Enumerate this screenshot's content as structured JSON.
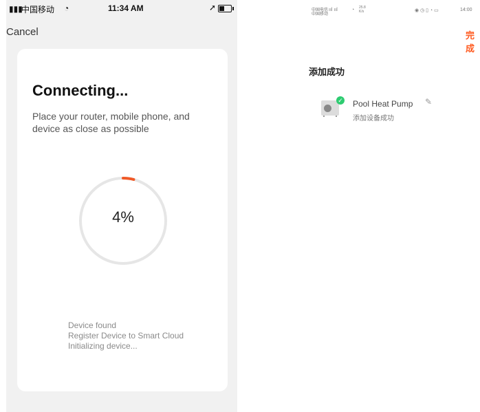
{
  "left_screen": {
    "status_bar": {
      "carrier": "中国移动",
      "time": "11:34 AM",
      "icons": [
        "signal-icon",
        "wifi-icon",
        "location-icon",
        "battery-icon"
      ]
    },
    "cancel_label": "Cancel",
    "card": {
      "title": "Connecting...",
      "description": "Place your router, mobile phone, and device as close as possible",
      "progress_label": "4%",
      "progress_value": 0.04,
      "accent_color": "#f05a28",
      "track_color": "#e6e6e6",
      "steps": [
        "Device found",
        "Register Device to Smart Cloud",
        "Initializing device..."
      ]
    }
  },
  "right_screen": {
    "status_bar": {
      "line1": "中国电信",
      "line2": "中国移动",
      "speed": "25.8",
      "speed_unit": "K/s",
      "time": "14:00",
      "icons": [
        "signal-icon",
        "wifi-icon",
        "eye-icon",
        "alarm-icon",
        "battery-icon"
      ]
    },
    "done_label": "完成",
    "done_color": "#ff5a1f",
    "success_title": "添加成功",
    "device": {
      "name": "Pool Heat Pump",
      "status": "添加设备成功",
      "badge_color": "#2ecc71",
      "icon": "heat-pump-icon"
    }
  }
}
